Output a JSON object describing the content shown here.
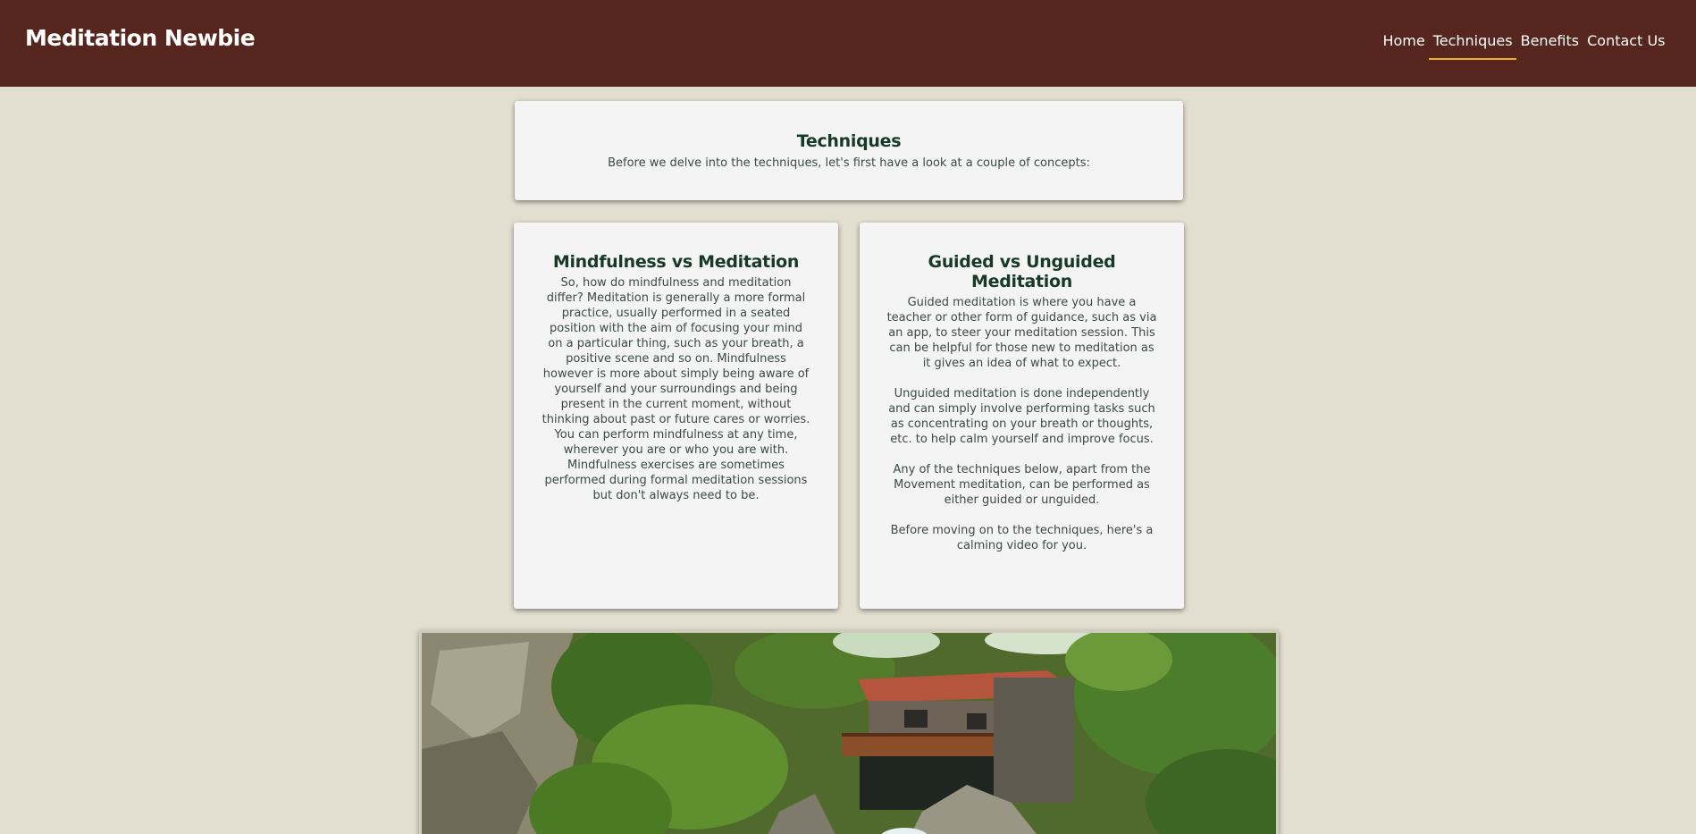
{
  "header": {
    "brand": "Meditation Newbie",
    "nav": [
      {
        "label": "Home",
        "active": false
      },
      {
        "label": "Techniques",
        "active": true
      },
      {
        "label": "Benefits",
        "active": false
      },
      {
        "label": "Contact Us",
        "active": false
      }
    ],
    "colors": {
      "background": "#56261e",
      "active_underline": "#e8b418"
    }
  },
  "intro": {
    "title": "Techniques",
    "text": "Before we delve into the techniques, let's first have a look at a couple of concepts:"
  },
  "mindfulness": {
    "title": "Mindfulness vs Meditation",
    "text": "So, how do mindfulness and meditation differ? Meditation is generally a more formal practice, usually performed in a seated position with the aim of focusing your mind on a particular thing, such as your breath, a positive scene and so on. Mindfulness however is more about simply being aware of yourself and your surroundings and being present in the current moment, without thinking about past or future cares or worries. You can perform mindfulness at any time, wherever you are or who you are with. Mindfulness exercises are sometimes performed during formal meditation sessions but don't always need to be."
  },
  "guided": {
    "title": "Guided vs Unguided Meditation",
    "paragraphs": [
      "Guided meditation is where you have a teacher or other form of guidance, such as via an app, to steer your meditation session. This can be helpful for those new to meditation as it gives an idea of what to expect.",
      "Unguided meditation is done independently and can simply involve performing tasks such as concentrating on your breath or thoughts, etc. to help calm yourself and improve focus.",
      "Any of the techniques below, apart from the Movement meditation, can be performed as either guided or unguided.",
      "Before moving on to the techniques, here's a calming video for you."
    ]
  },
  "video": {
    "scene": "stone mill house above a river gorge with trees and rocks"
  }
}
